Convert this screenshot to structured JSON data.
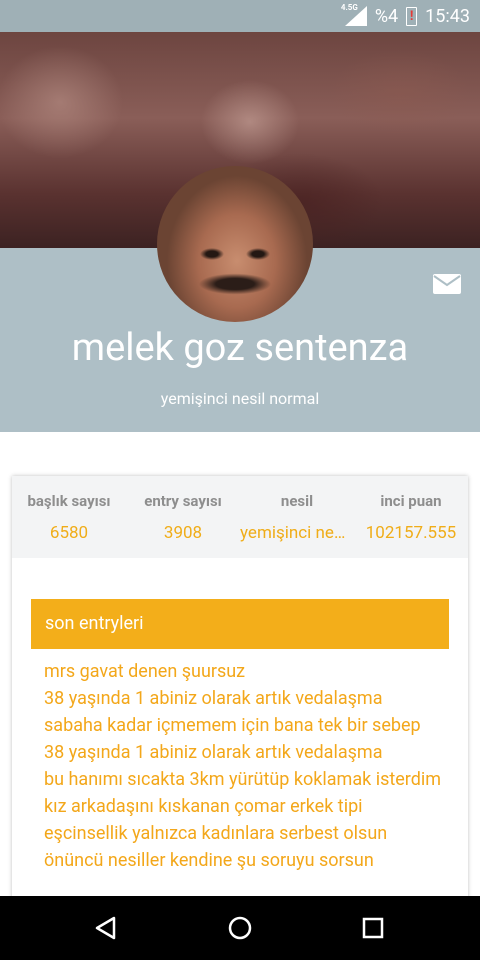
{
  "status_bar": {
    "battery_percent": "%4",
    "time": "15:43",
    "network_type": "4.5G",
    "icons": [
      "signal-icon",
      "battery-low-icon"
    ]
  },
  "profile": {
    "name": "melek goz sentenza",
    "subtitle": "yemişinci nesil normal",
    "message_icon": "mail-icon"
  },
  "stats": [
    {
      "label": "başlık sayısı",
      "value": "6580"
    },
    {
      "label": "entry sayısı",
      "value": "3908"
    },
    {
      "label": "nesil",
      "value": "yemişinci nesil normal"
    },
    {
      "label": "inci puan",
      "value": "102157.555"
    }
  ],
  "recent": {
    "header": "son entryleri",
    "entries": [
      "mrs gavat denen şuursuz",
      "38 yaşında 1 abiniz olarak artık vedalaşma",
      "sabaha kadar içmemem için bana tek bir sebep",
      "38 yaşında 1 abiniz olarak artık vedalaşma",
      "bu hanımı sıcakta 3km yürütüp koklamak isterdim",
      "kız arkadaşını kıskanan çomar erkek tipi",
      "eşcinsellik yalnızca kadınlara serbest olsun",
      "önüncü nesiller kendine şu soruyu sorsun"
    ]
  },
  "nav": {
    "back_icon": "back-icon",
    "home_icon": "home-icon",
    "recents_icon": "recents-icon"
  },
  "colors": {
    "accent": "#f3ae1a",
    "band": "#aebfc6",
    "status_bar": "#9fb0b6"
  }
}
